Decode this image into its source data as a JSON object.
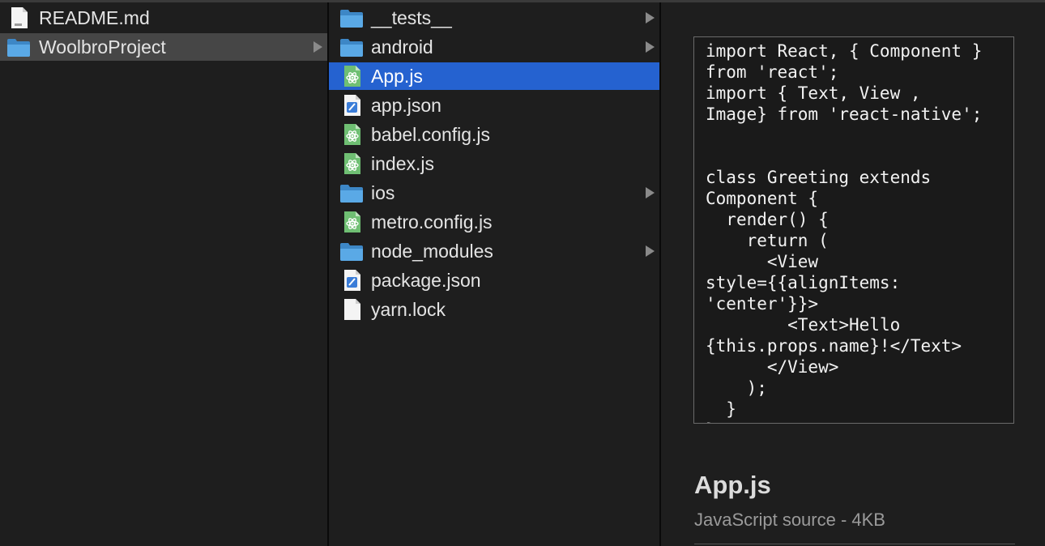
{
  "columns": {
    "parent": {
      "items": [
        {
          "label": "README.md",
          "icon": "markdown-file-icon",
          "is_folder": false,
          "selected": false
        },
        {
          "label": "WoolbroProject",
          "icon": "folder-icon",
          "is_folder": true,
          "selected": true
        }
      ]
    },
    "project": {
      "items": [
        {
          "label": "__tests__",
          "icon": "folder-icon",
          "is_folder": true
        },
        {
          "label": "android",
          "icon": "folder-icon",
          "is_folder": true
        },
        {
          "label": "App.js",
          "icon": "js-file-icon",
          "is_folder": false,
          "selected": true
        },
        {
          "label": "app.json",
          "icon": "json-file-icon",
          "is_folder": false
        },
        {
          "label": "babel.config.js",
          "icon": "js-file-icon",
          "is_folder": false
        },
        {
          "label": "index.js",
          "icon": "js-file-icon",
          "is_folder": false
        },
        {
          "label": "ios",
          "icon": "folder-icon",
          "is_folder": true
        },
        {
          "label": "metro.config.js",
          "icon": "js-file-icon",
          "is_folder": false
        },
        {
          "label": "node_modules",
          "icon": "folder-icon",
          "is_folder": true
        },
        {
          "label": "package.json",
          "icon": "json-file-icon",
          "is_folder": false
        },
        {
          "label": "yarn.lock",
          "icon": "blank-file-icon",
          "is_folder": false
        }
      ]
    }
  },
  "preview": {
    "code": "import React, { Component }\nfrom 'react';\nimport { Text, View ,\nImage} from 'react-native';\n\n\nclass Greeting extends\nComponent {\n  render() {\n    return (\n      <View\nstyle={{alignItems:\n'center'}}>\n        <Text>Hello\n{this.props.name}!</Text>\n      </View>\n    );\n  }\n}",
    "file_name": "App.js",
    "file_kind": "JavaScript source - 4KB"
  },
  "colors": {
    "selection_blue": "#2562d0",
    "selection_gray": "#464646",
    "background": "#1e1e1e",
    "folder": "#5aa9e6",
    "js_icon": "#6fbf73"
  }
}
